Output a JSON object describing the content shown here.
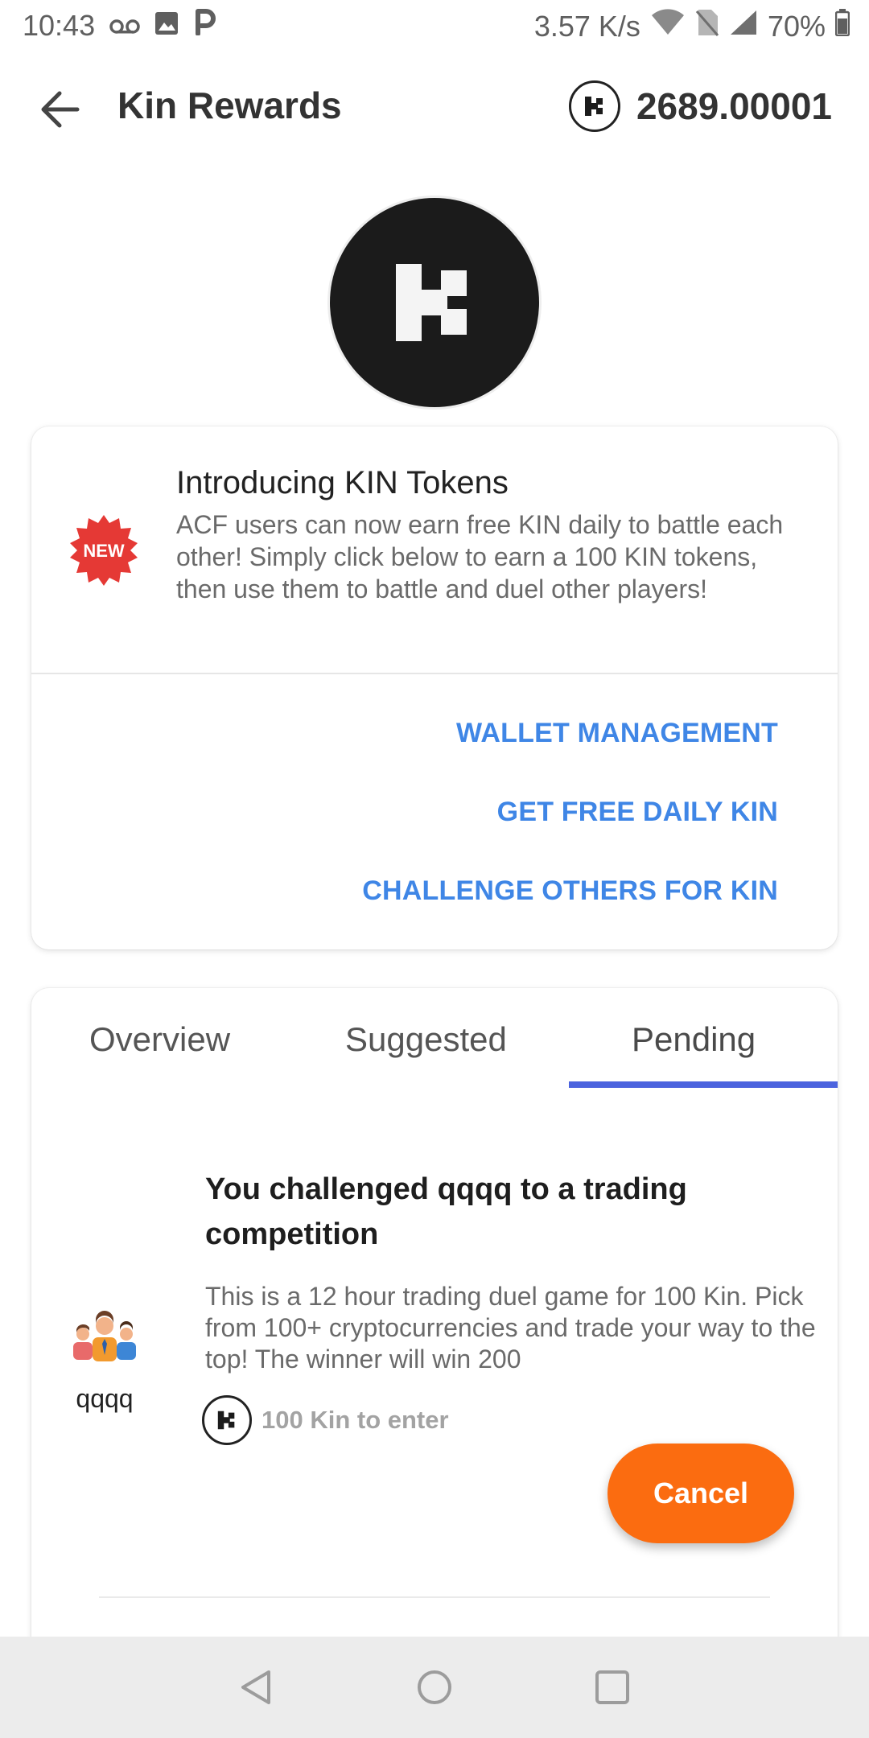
{
  "status_bar": {
    "time": "10:43",
    "left_icons": [
      "voicemail-icon",
      "image-icon",
      "p-app-icon"
    ],
    "speed": "3.57 K/s",
    "battery": "70%"
  },
  "app_bar": {
    "title": "Kin Rewards",
    "balance": "2689.00001"
  },
  "intro_card": {
    "badge": "NEW",
    "title": "Introducing KIN Tokens",
    "body": "ACF users can now earn free KIN daily to battle each other! Simply click below to earn a 100 KIN tokens, then use them to battle and duel other players!",
    "actions": [
      "WALLET MANAGEMENT",
      "GET FREE DAILY KIN",
      "CHALLENGE OTHERS FOR KIN"
    ]
  },
  "tabs": {
    "items": [
      "Overview",
      "Suggested",
      "Pending"
    ],
    "selected": "Pending"
  },
  "challenge": {
    "username": "qqqq",
    "title": "You challenged qqqq to a trading competition",
    "body": "This is a 12 hour trading duel game for 100 Kin. Pick from 100+ cryptocurrencies and trade your way to the top! The winner will win 200",
    "entry": "100 Kin to enter",
    "cancel_label": "Cancel"
  },
  "colors": {
    "accent_blue": "#3f86e6",
    "tab_indicator": "#4b63de",
    "cancel_orange": "#fb6c10",
    "badge_red": "#e53935"
  }
}
